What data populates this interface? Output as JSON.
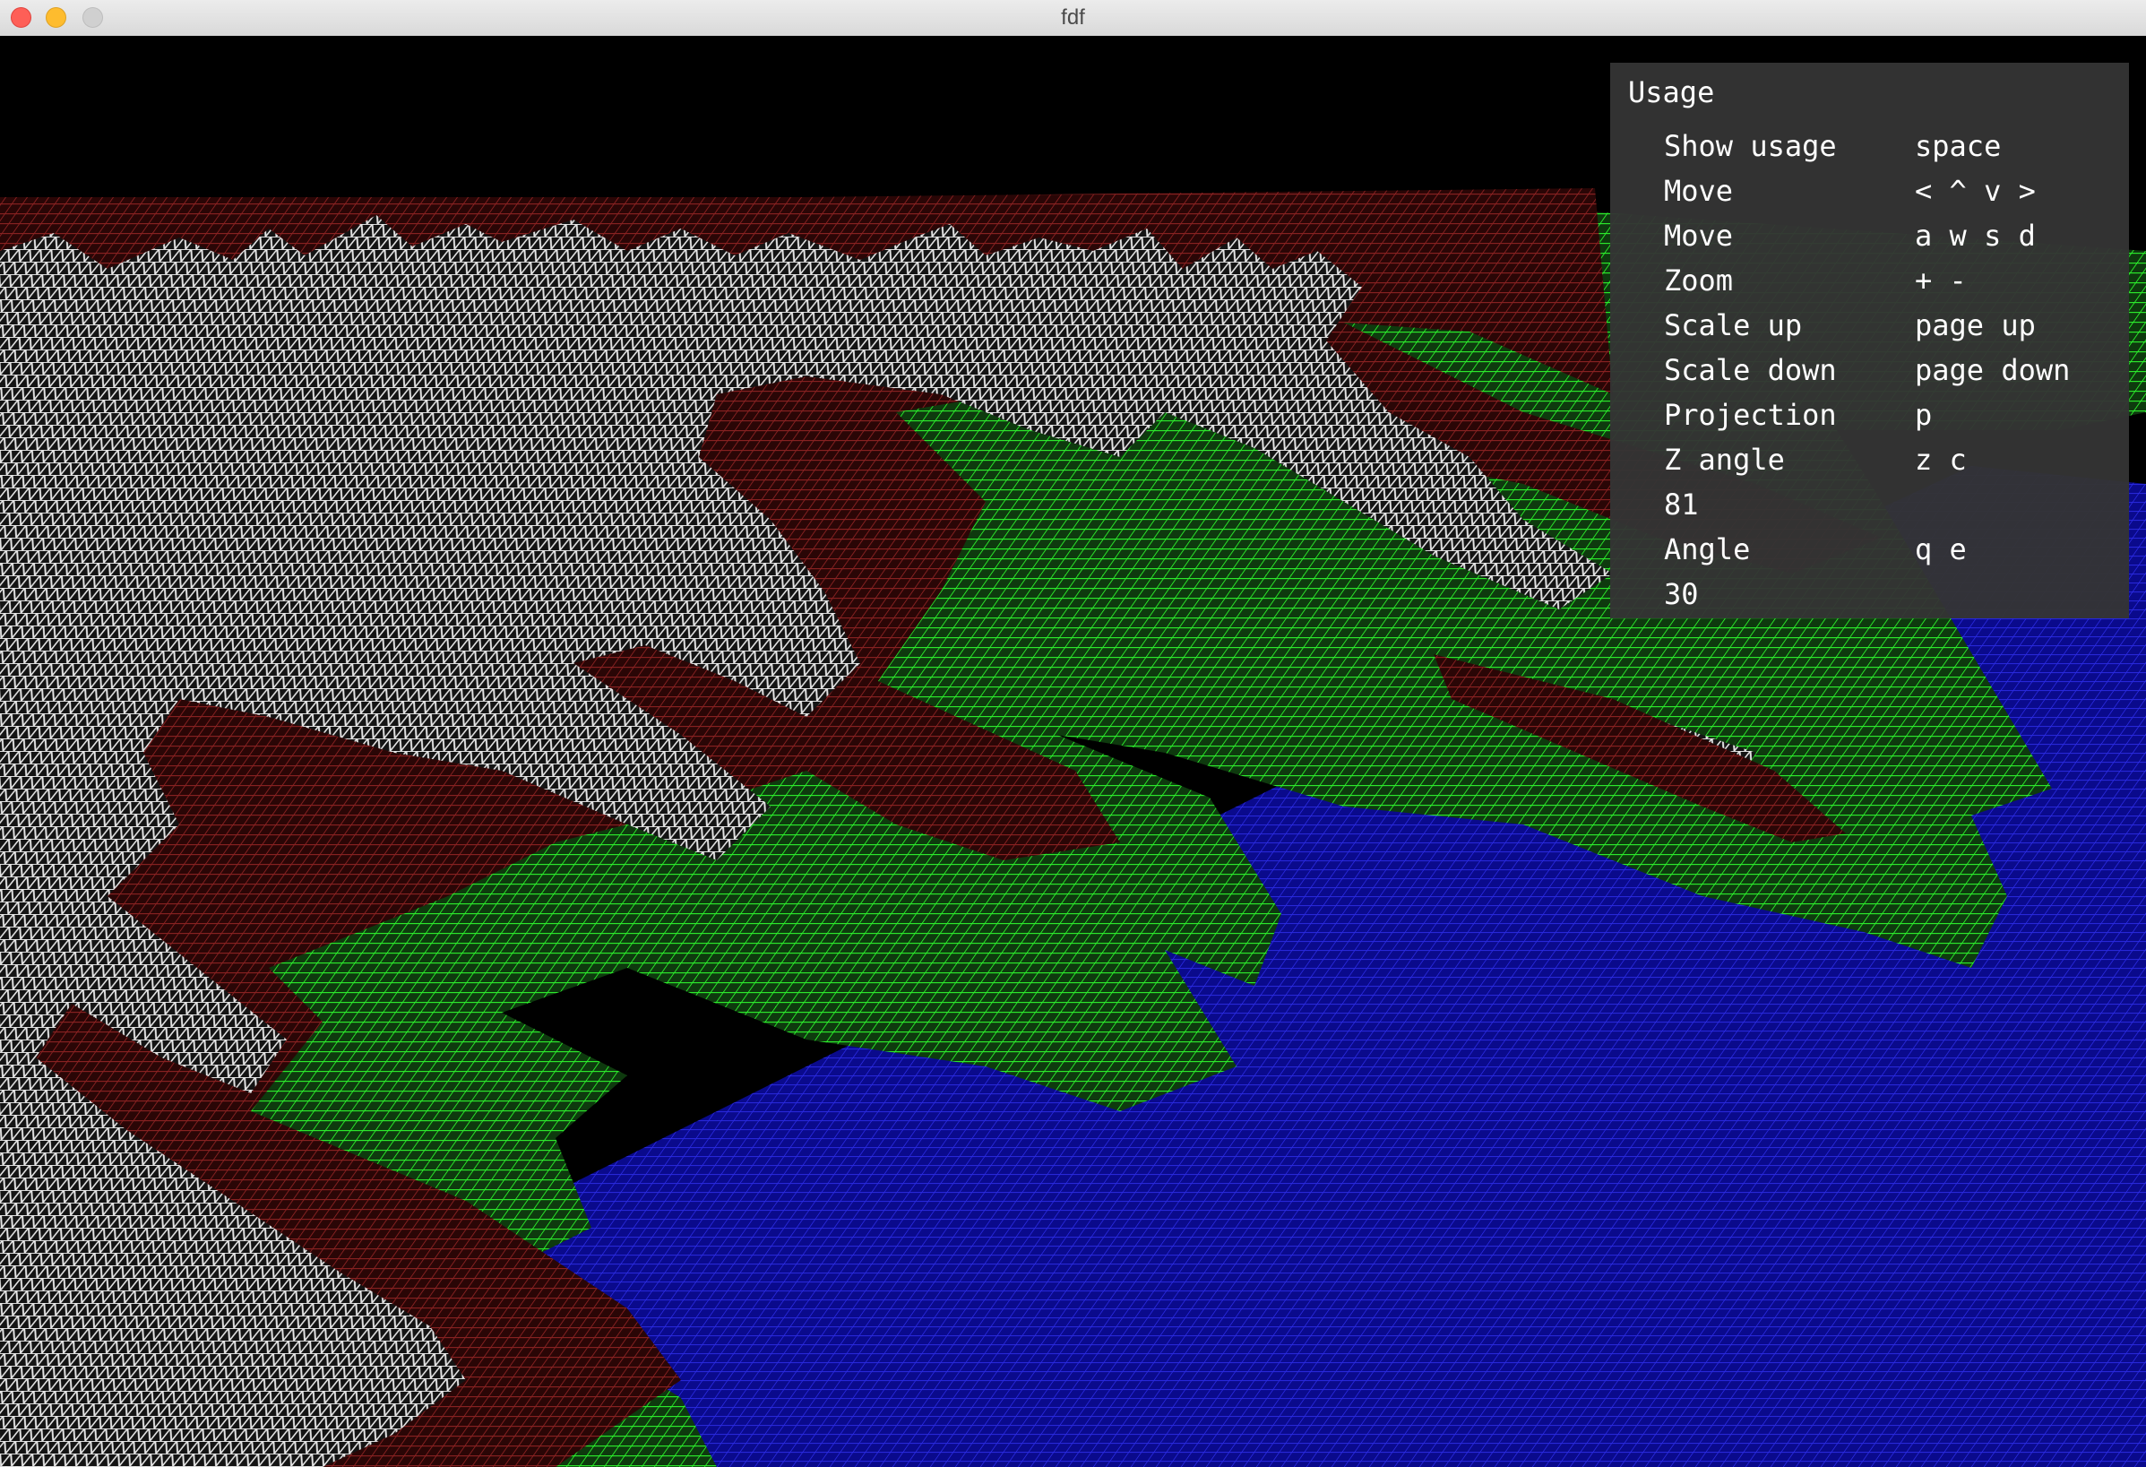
{
  "window": {
    "title": "fdf"
  },
  "usage": {
    "title": "Usage",
    "rows": [
      {
        "action": "Show usage",
        "key": "space"
      },
      {
        "action": "Move",
        "key": "< ^ v >"
      },
      {
        "action": "Move",
        "key": "a w s d"
      },
      {
        "action": "Zoom",
        "key": "+ -"
      },
      {
        "action": "Scale up",
        "key": "page up"
      },
      {
        "action": "Scale down",
        "key": "page down"
      },
      {
        "action": "Projection",
        "key": "p"
      },
      {
        "action": "Z angle",
        "key": "z c"
      }
    ],
    "z_angle_value": "81",
    "angle_row": {
      "action": "Angle",
      "key": "q e"
    },
    "angle_value": "30"
  },
  "colors": {
    "background": "#000000",
    "water": "#1c1cc8",
    "lowland": "#22e222",
    "hill": "#7a1c1c",
    "peak": "#d9d9d9",
    "panel": "#343434"
  },
  "icons": [
    "close-light-icon",
    "minimize-light-icon",
    "maximize-light-icon"
  ]
}
